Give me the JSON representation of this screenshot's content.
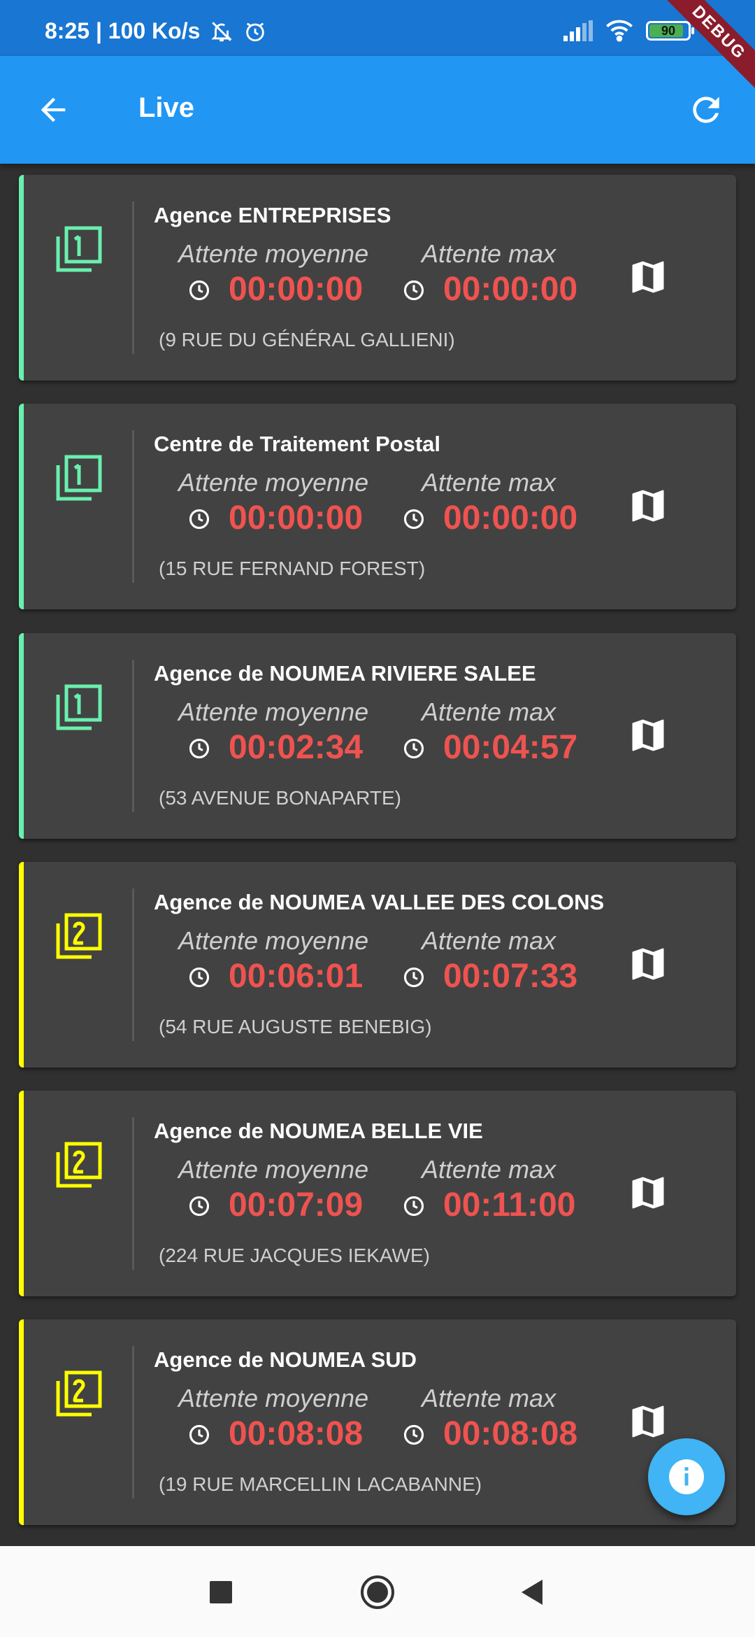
{
  "status_bar": {
    "time_speed": "8:25 | 100 Ko/s",
    "battery": "90",
    "debug_banner": "DEBUG"
  },
  "app_bar": {
    "title": "Live"
  },
  "colors": {
    "appbar": "#2196f3",
    "statusbar": "#1976d2",
    "level1": "#69f0ae",
    "level2": "#ffff00",
    "time": "#ef5350",
    "card": "#424242",
    "fab": "#40b4f4"
  },
  "labels": {
    "avg": "Attente moyenne",
    "max": "Attente max"
  },
  "agencies": [
    {
      "name": "Agence ENTREPRISES",
      "avg": "00:00:00",
      "max": "00:00:00",
      "address": "(9 RUE DU GÉNÉRAL GALLIENI)",
      "level": 1
    },
    {
      "name": "Centre de Traitement Postal",
      "avg": "00:00:00",
      "max": "00:00:00",
      "address": "(15 RUE FERNAND FOREST)",
      "level": 1
    },
    {
      "name": "Agence de NOUMEA RIVIERE SALEE",
      "avg": "00:02:34",
      "max": "00:04:57",
      "address": "(53 AVENUE BONAPARTE)",
      "level": 1
    },
    {
      "name": "Agence de NOUMEA VALLEE DES COLONS",
      "avg": "00:06:01",
      "max": "00:07:33",
      "address": "(54 RUE AUGUSTE BENEBIG)",
      "level": 2
    },
    {
      "name": "Agence de NOUMEA BELLE VIE",
      "avg": "00:07:09",
      "max": "00:11:00",
      "address": "(224 RUE JACQUES IEKAWE)",
      "level": 2
    },
    {
      "name": "Agence de NOUMEA SUD",
      "avg": "00:08:08",
      "max": "00:08:08",
      "address": "(19 RUE MARCELLIN LACABANNE)",
      "level": 2
    }
  ],
  "icons": {
    "back": "arrow-back-icon",
    "refresh": "refresh-icon",
    "level1": "filter-1-icon",
    "level2": "filter-2-icon",
    "clock": "clock-icon",
    "map": "map-icon",
    "info": "info-icon"
  }
}
